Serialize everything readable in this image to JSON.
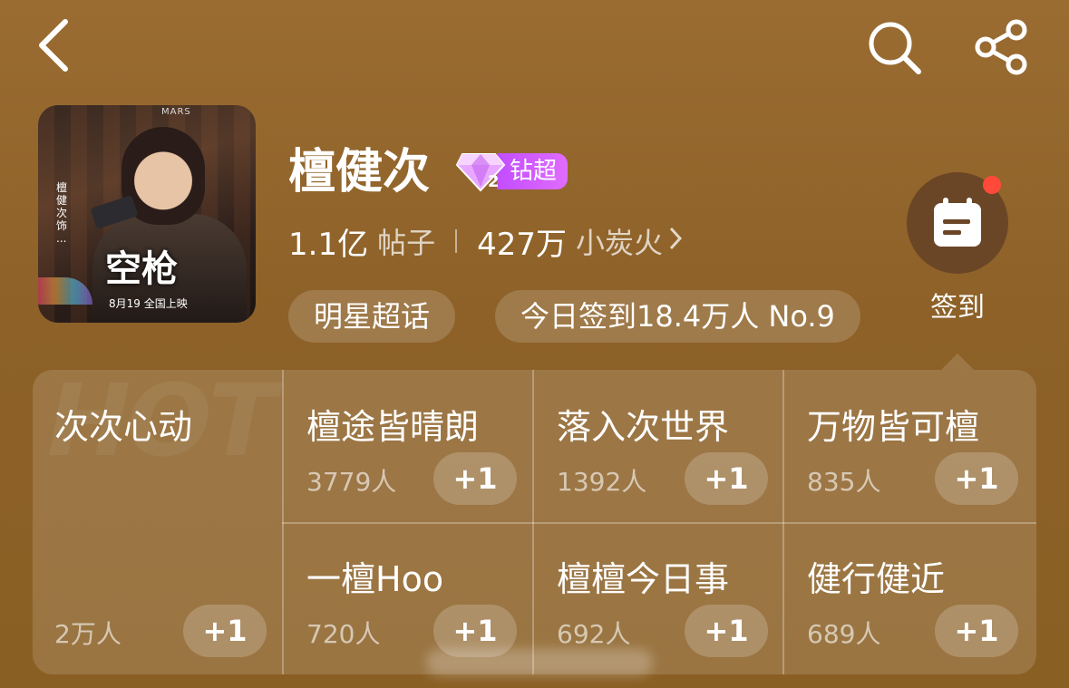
{
  "header": {
    "back_icon": "back-arrow-icon",
    "search_icon": "search-icon",
    "share_icon": "share-icon"
  },
  "topic": {
    "cover": {
      "movie_title": "空枪",
      "date_text": "8月19 全国上映",
      "side_text": "檀健次 饰 ...",
      "brand": "MARS"
    },
    "name": "檀健次",
    "badge": {
      "level": "2",
      "label": "钻超",
      "color": "#c24dff"
    },
    "posts_count": "1.1亿",
    "posts_label": "帖子",
    "fans_count": "427万",
    "fans_label": "小炭火",
    "tag": "明星超话",
    "checkin_status": "今日签到18.4万人 No.9"
  },
  "checkin": {
    "label": "签到",
    "icon": "calendar-icon",
    "has_notification": true
  },
  "hot_panel": {
    "watermark": "HOT",
    "featured": {
      "title": "次次心动",
      "count": "2万人",
      "button": "+1"
    },
    "items": [
      {
        "title": "檀途皆晴朗",
        "count": "3779人",
        "button": "+1"
      },
      {
        "title": "落入次世界",
        "count": "1392人",
        "button": "+1"
      },
      {
        "title": "万物皆可檀",
        "count": "835人",
        "button": "+1"
      },
      {
        "title": "一檀Hoo",
        "count": "720人",
        "button": "+1"
      },
      {
        "title": "檀檀今日事",
        "count": "692人",
        "button": "+1"
      },
      {
        "title": "健行健近",
        "count": "689人",
        "button": "+1"
      }
    ]
  }
}
